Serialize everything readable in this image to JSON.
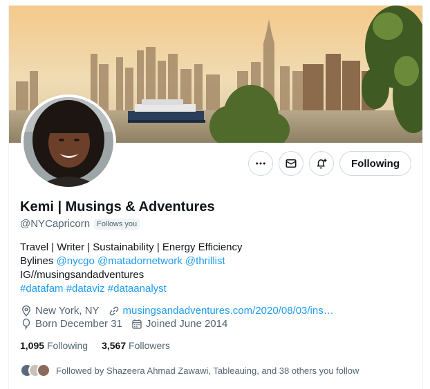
{
  "profile": {
    "name": "Kemi | Musings & Adventures",
    "handle": "@NYCapricorn",
    "follows_you": "Follows you",
    "bio_line1": "Travel | Writer | Sustainability | Energy Efficiency",
    "bio_bylines_prefix": "Bylines",
    "bio_mention1": "@nycgo",
    "bio_mention2": "@matadornetwork",
    "bio_mention3": "@thrillist",
    "bio_line3": "IG//musingsandadventures",
    "bio_tag1": "#datafam",
    "bio_tag2": "#dataviz",
    "bio_tag3": "#dataanalyst",
    "location": "New York, NY",
    "website": "musingsandadventures.com/2020/08/03/ins…",
    "birthday": "Born December 31",
    "joined": "Joined June 2014",
    "following_count": "1,095",
    "following_label": "Following",
    "followers_count": "3,567",
    "followers_label": "Followers",
    "followed_by": "Followed by Shazeera Ahmad Zawawi, Tableauing, and 38 others you follow"
  },
  "actions": {
    "more_icon": "more-icon",
    "message_icon": "envelope-icon",
    "notify_icon": "bell-plus-icon",
    "following_label": "Following"
  },
  "colors": {
    "accent": "#1d9bf0",
    "secondary_text": "#536471",
    "primary_text": "#0f1419"
  }
}
